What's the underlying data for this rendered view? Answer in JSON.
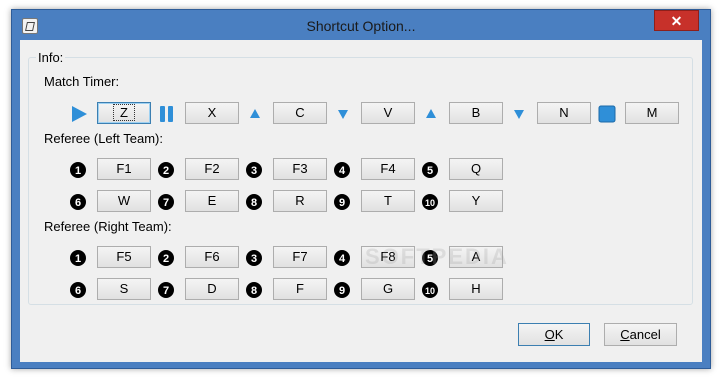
{
  "window": {
    "title": "Shortcut Option...",
    "close_glyph": "✕"
  },
  "info_group": {
    "label": "Info:"
  },
  "match_timer": {
    "label": "Match Timer:",
    "controls": [
      {
        "icon": "play-icon",
        "key": "Z",
        "focused": true
      },
      {
        "icon": "pause-icon",
        "key": "X"
      },
      {
        "icon": "up-arrow-icon",
        "key": "C"
      },
      {
        "icon": "down-arrow-icon",
        "key": "V"
      },
      {
        "icon": "up-arrow-icon",
        "key": "B"
      },
      {
        "icon": "down-arrow-icon",
        "key": "N"
      },
      {
        "icon": "stop-icon",
        "key": "M"
      }
    ]
  },
  "referee_left": {
    "label": "Referee (Left Team):",
    "row1": [
      {
        "num": "1",
        "key": "F1"
      },
      {
        "num": "2",
        "key": "F2"
      },
      {
        "num": "3",
        "key": "F3"
      },
      {
        "num": "4",
        "key": "F4"
      },
      {
        "num": "5",
        "key": "Q"
      }
    ],
    "row2": [
      {
        "num": "6",
        "key": "W"
      },
      {
        "num": "7",
        "key": "E"
      },
      {
        "num": "8",
        "key": "R"
      },
      {
        "num": "9",
        "key": "T"
      },
      {
        "num": "10",
        "key": "Y"
      }
    ]
  },
  "referee_right": {
    "label": "Referee (Right Team):",
    "row1": [
      {
        "num": "1",
        "key": "F5"
      },
      {
        "num": "2",
        "key": "F6"
      },
      {
        "num": "3",
        "key": "F7"
      },
      {
        "num": "4",
        "key": "F8"
      },
      {
        "num": "5",
        "key": "A"
      }
    ],
    "row2": [
      {
        "num": "6",
        "key": "S"
      },
      {
        "num": "7",
        "key": "D"
      },
      {
        "num": "8",
        "key": "F"
      },
      {
        "num": "9",
        "key": "G"
      },
      {
        "num": "10",
        "key": "H"
      }
    ]
  },
  "buttons": {
    "ok": {
      "mnemonic": "O",
      "rest": "K"
    },
    "cancel": {
      "mnemonic": "C",
      "rest": "ancel"
    }
  },
  "watermark": "SOFTPEDIA",
  "colors": {
    "accent": "#2f8fd8",
    "frame": "#4a7fc1",
    "close": "#c7312a"
  }
}
